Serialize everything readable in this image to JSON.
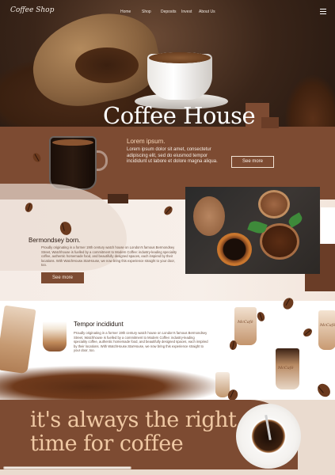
{
  "brand": {
    "logo": "Coffee Shop"
  },
  "nav": {
    "items": [
      "Home",
      "Shop",
      "Deposits",
      "Invest",
      "About Us"
    ]
  },
  "hero": {
    "title": "Coffee House"
  },
  "intro": {
    "heading": "Lorem ipsum.",
    "body": "Lorem ipsum dolor sit amet, consectetur adipiscing elit, sed do eiusmod tempor incididunt ut labore et dolore magna aliqua.",
    "button": "See more"
  },
  "about": {
    "heading": "Bermondsey born.",
    "body": "Proudly originating in a former 19th century watch house on London's famous Bermondsey Street, Watchhouse is fuelled by a commitment to Modern Coffee: industry-leading speciality coffee, authentic homemade food, and beautifully designed spaces, each inspired by their locations. With WatchHouse.StarHouse, we now bring this experience straight to your door, too.",
    "button": "See more"
  },
  "tempor": {
    "heading": "Tempor incididunt",
    "body": "Proudly originating in a former 19th century watch house on London's famous Bermondsey Street, Watchhouse is fuelled by a commitment to Modern Coffee: industry-leading speciality coffee, authentic homemade food, and beautifully designed spaces, each inspired by their locations. With WatchHouse.StarHouse, we now bring this experience straight to your door, too."
  },
  "cups": {
    "label": "McCafé"
  },
  "footer": {
    "tagline": "it's always the right time for coffee"
  },
  "colors": {
    "brown": "#7d4b32",
    "cream": "#eadbcf",
    "accent": "#f0c9a4"
  },
  "icons": {
    "menu": "hamburger-icon"
  }
}
